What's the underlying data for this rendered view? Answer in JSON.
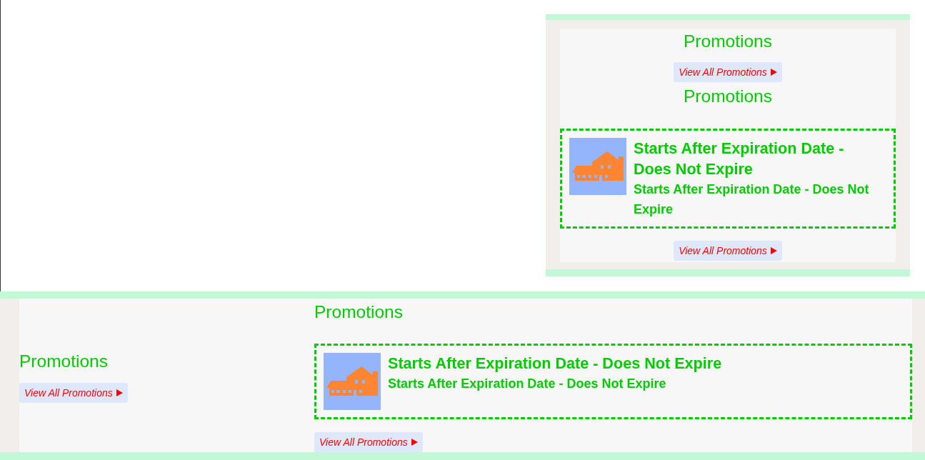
{
  "sidebar_widget": {
    "heading": "Promotions",
    "view_all": "View All Promotions",
    "list": {
      "heading": "Promotions",
      "promotions": [
        {
          "title": "Starts After Expiration Date - Does Not Expire",
          "description": "Starts After Expiration Date - Does Not Expire"
        }
      ],
      "view_all": "View All Promotions"
    }
  },
  "footer_widget": {
    "side": {
      "heading": "Promotions",
      "view_all": "View All Promotions"
    },
    "list": {
      "heading": "Promotions",
      "promotions": [
        {
          "title": "Starts After Expiration Date - Does Not Expire",
          "description": "Starts After Expiration Date - Does Not Expire"
        }
      ],
      "view_all": "View All Promotions"
    }
  }
}
